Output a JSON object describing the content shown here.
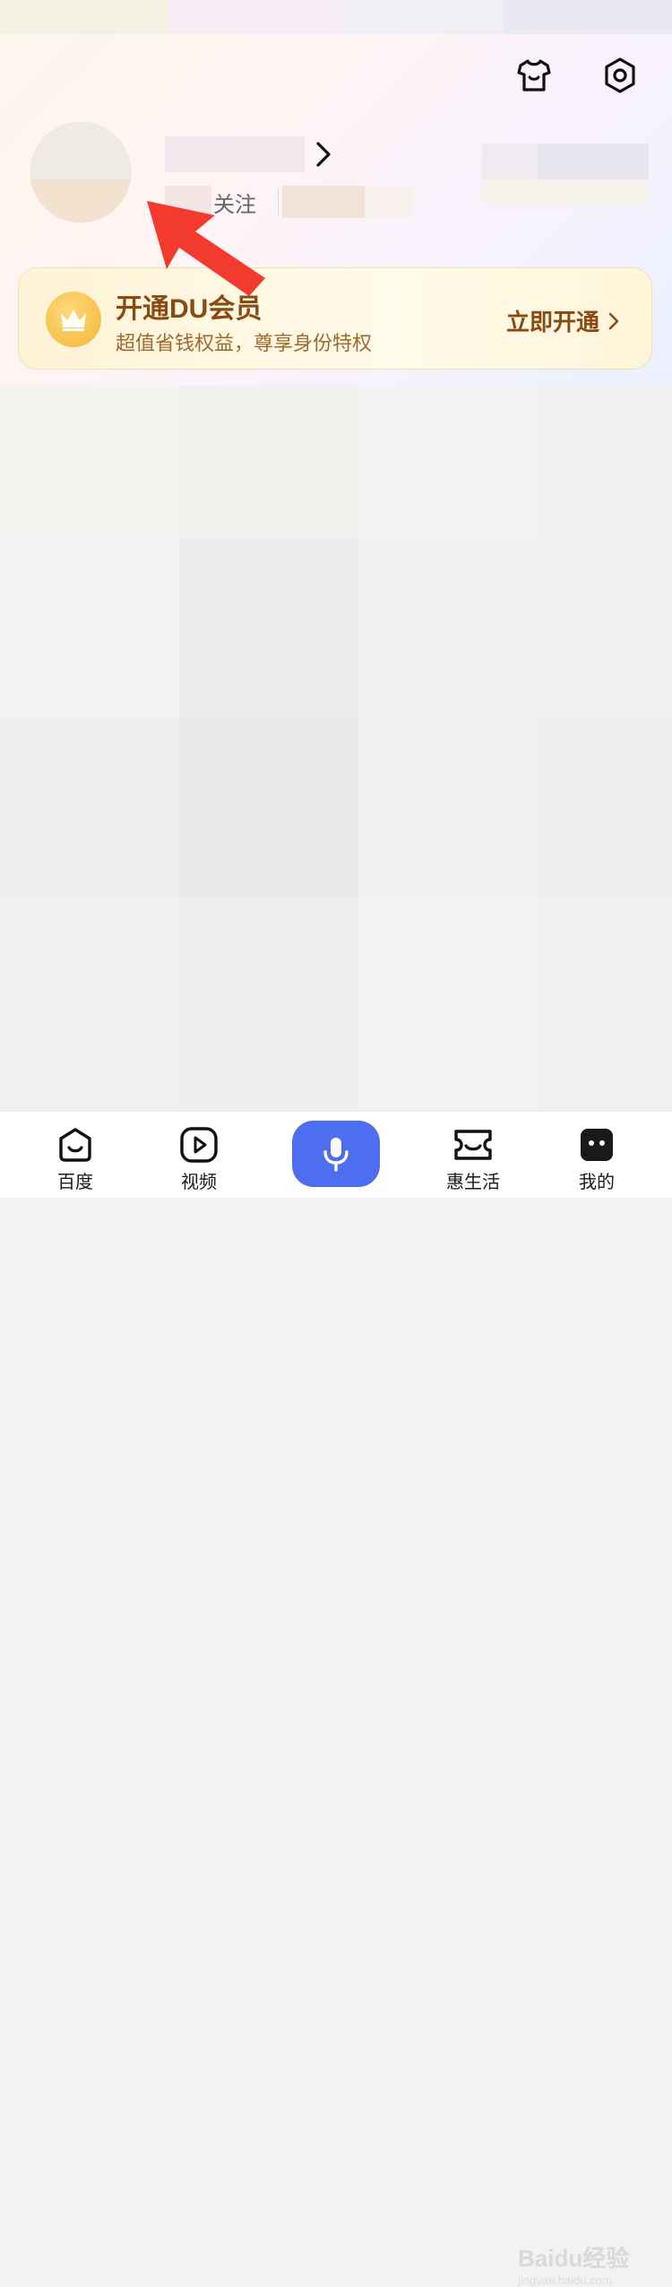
{
  "header": {
    "follow_label": "关注"
  },
  "vip": {
    "title": "开通DU会员",
    "subtitle": "超值省钱权益，尊享身份特权",
    "cta": "立即开通"
  },
  "tabbar": {
    "items": [
      {
        "label": "百度",
        "icon": "baidu-face-icon"
      },
      {
        "label": "视频",
        "icon": "video-play-icon"
      },
      {
        "label": "",
        "icon": "microphone-icon"
      },
      {
        "label": "惠生活",
        "icon": "ticket-smile-icon"
      },
      {
        "label": "我的",
        "icon": "my-profile-icon"
      }
    ]
  },
  "watermark": {
    "text": "Baidu经验",
    "url": "jingyan.baidu.com"
  },
  "colors": {
    "accent_blue": "#4e6ef2",
    "vip_brown": "#8a4b12",
    "arrow_red": "#f23a2e"
  }
}
